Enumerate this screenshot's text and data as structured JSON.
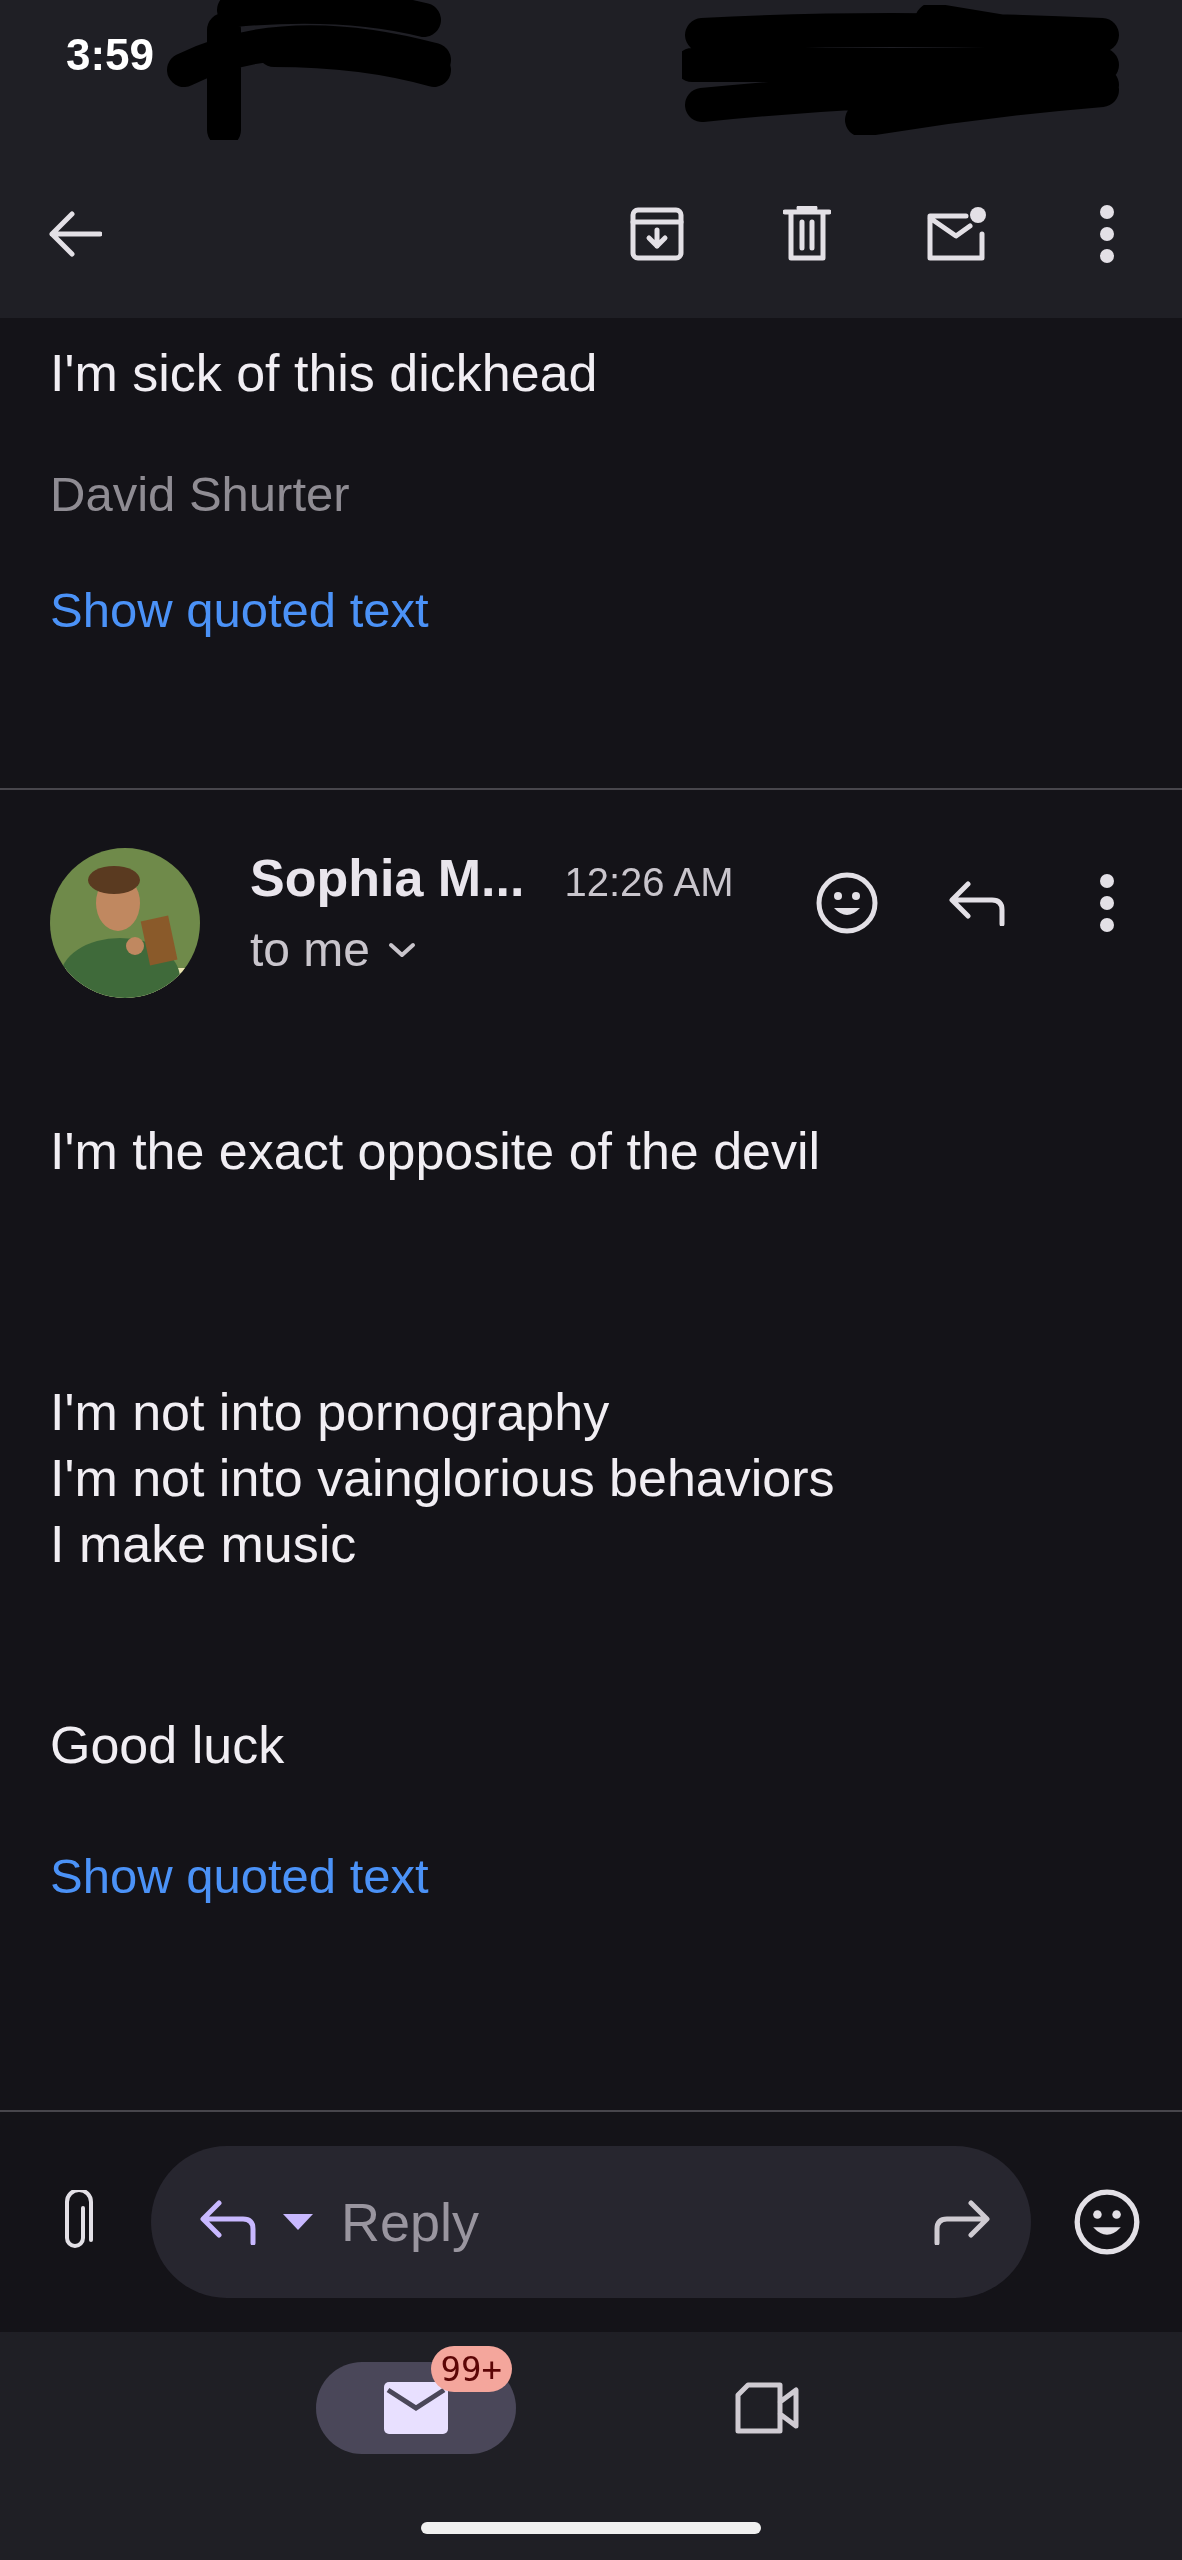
{
  "status_bar": {
    "time": "3:59"
  },
  "toolbar": {
    "actions": [
      {
        "kind": "archive"
      },
      {
        "kind": "delete"
      },
      {
        "kind": "unread"
      },
      {
        "kind": "more"
      }
    ]
  },
  "previous_message": {
    "lines": [
      "I'm sick of this dickhead"
    ],
    "signature": "David Shurter",
    "show_quoted": "Show quoted text"
  },
  "message": {
    "sender": "Sophia M...",
    "time": "12:26 AM",
    "recipient": "to me",
    "paragraphs": [
      [
        "I'm the exact opposite of the devil"
      ],
      [
        "I'm not into pornography",
        "I'm not into vainglorious behaviors",
        "I make music"
      ],
      [
        "Good luck"
      ]
    ],
    "show_quoted": "Show quoted text"
  },
  "reply_bar": {
    "placeholder": "Reply"
  },
  "nav": [
    {
      "kind": "mail",
      "selected": true,
      "badge": "99+"
    },
    {
      "kind": "video",
      "selected": false
    }
  ]
}
